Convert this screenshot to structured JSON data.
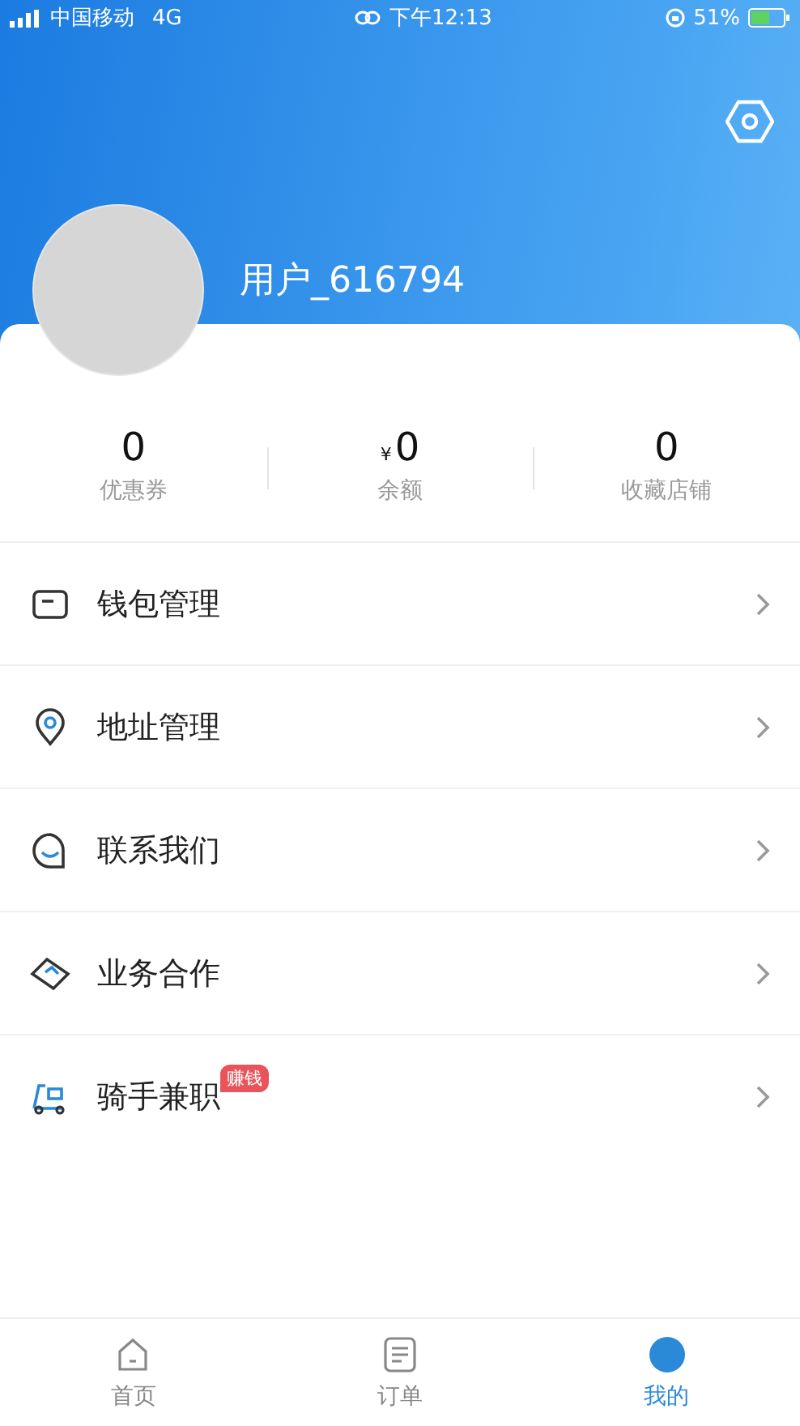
{
  "status_bar": {
    "carrier": "中国移动",
    "network": "4G",
    "time": "下午12:13",
    "battery": "51%"
  },
  "profile": {
    "username": "用户_616794"
  },
  "stats": [
    {
      "value": "0",
      "label": "优惠券"
    },
    {
      "value": "0",
      "prefix": "¥",
      "label": "余额"
    },
    {
      "value": "0",
      "label": "收藏店铺"
    }
  ],
  "menu": [
    {
      "kind": "wallet",
      "label": "钱包管理"
    },
    {
      "kind": "location",
      "label": "地址管理"
    },
    {
      "kind": "chat",
      "label": "联系我们"
    },
    {
      "kind": "handshake",
      "label": "业务合作"
    },
    {
      "kind": "scooter",
      "label": "骑手兼职",
      "badge": "赚钱"
    }
  ],
  "tab_bar": [
    {
      "kind": "home",
      "label": "首页",
      "selected": false
    },
    {
      "kind": "orders",
      "label": "订单",
      "selected": false
    },
    {
      "kind": "me",
      "label": "我的",
      "selected": true
    }
  ]
}
